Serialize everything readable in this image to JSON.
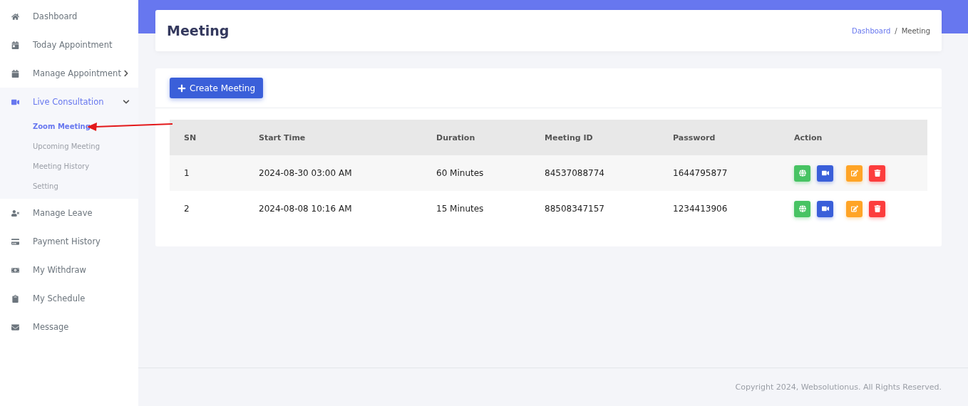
{
  "sidebar": {
    "items": [
      {
        "label": "Dashboard",
        "selected": false
      },
      {
        "label": "Today Appointment",
        "selected": false
      },
      {
        "label": "Manage Appointment",
        "selected": false,
        "expanded": false
      },
      {
        "label": "Live Consultation",
        "selected": true,
        "expanded": true,
        "children": [
          {
            "label": "Zoom Meeting",
            "selected": true
          },
          {
            "label": "Upcoming Meeting",
            "selected": false
          },
          {
            "label": "Meeting History",
            "selected": false
          },
          {
            "label": "Setting",
            "selected": false
          }
        ]
      },
      {
        "label": "Manage Leave",
        "selected": false
      },
      {
        "label": "Payment History",
        "selected": false
      },
      {
        "label": "My Withdraw",
        "selected": false
      },
      {
        "label": "My Schedule",
        "selected": false
      },
      {
        "label": "Message",
        "selected": false
      }
    ]
  },
  "header": {
    "title": "Meeting",
    "breadcrumb": [
      "Dashboard",
      "Meeting"
    ],
    "separator": "/"
  },
  "create_button": "Create Meeting",
  "table": {
    "columns": [
      "SN",
      "Start Time",
      "Duration",
      "Meeting ID",
      "Password",
      "Action"
    ],
    "rows": [
      {
        "cells": [
          "1",
          "2024-08-30 03:00 AM",
          "60 Minutes",
          "84537088774",
          "1644795877"
        ]
      },
      {
        "cells": [
          "2",
          "2024-08-08 10:16 AM",
          "15 Minutes",
          "88508347157",
          "1234413906"
        ]
      }
    ]
  },
  "footer": "Copyright 2024, Websolutionus. All Rights Reserved."
}
